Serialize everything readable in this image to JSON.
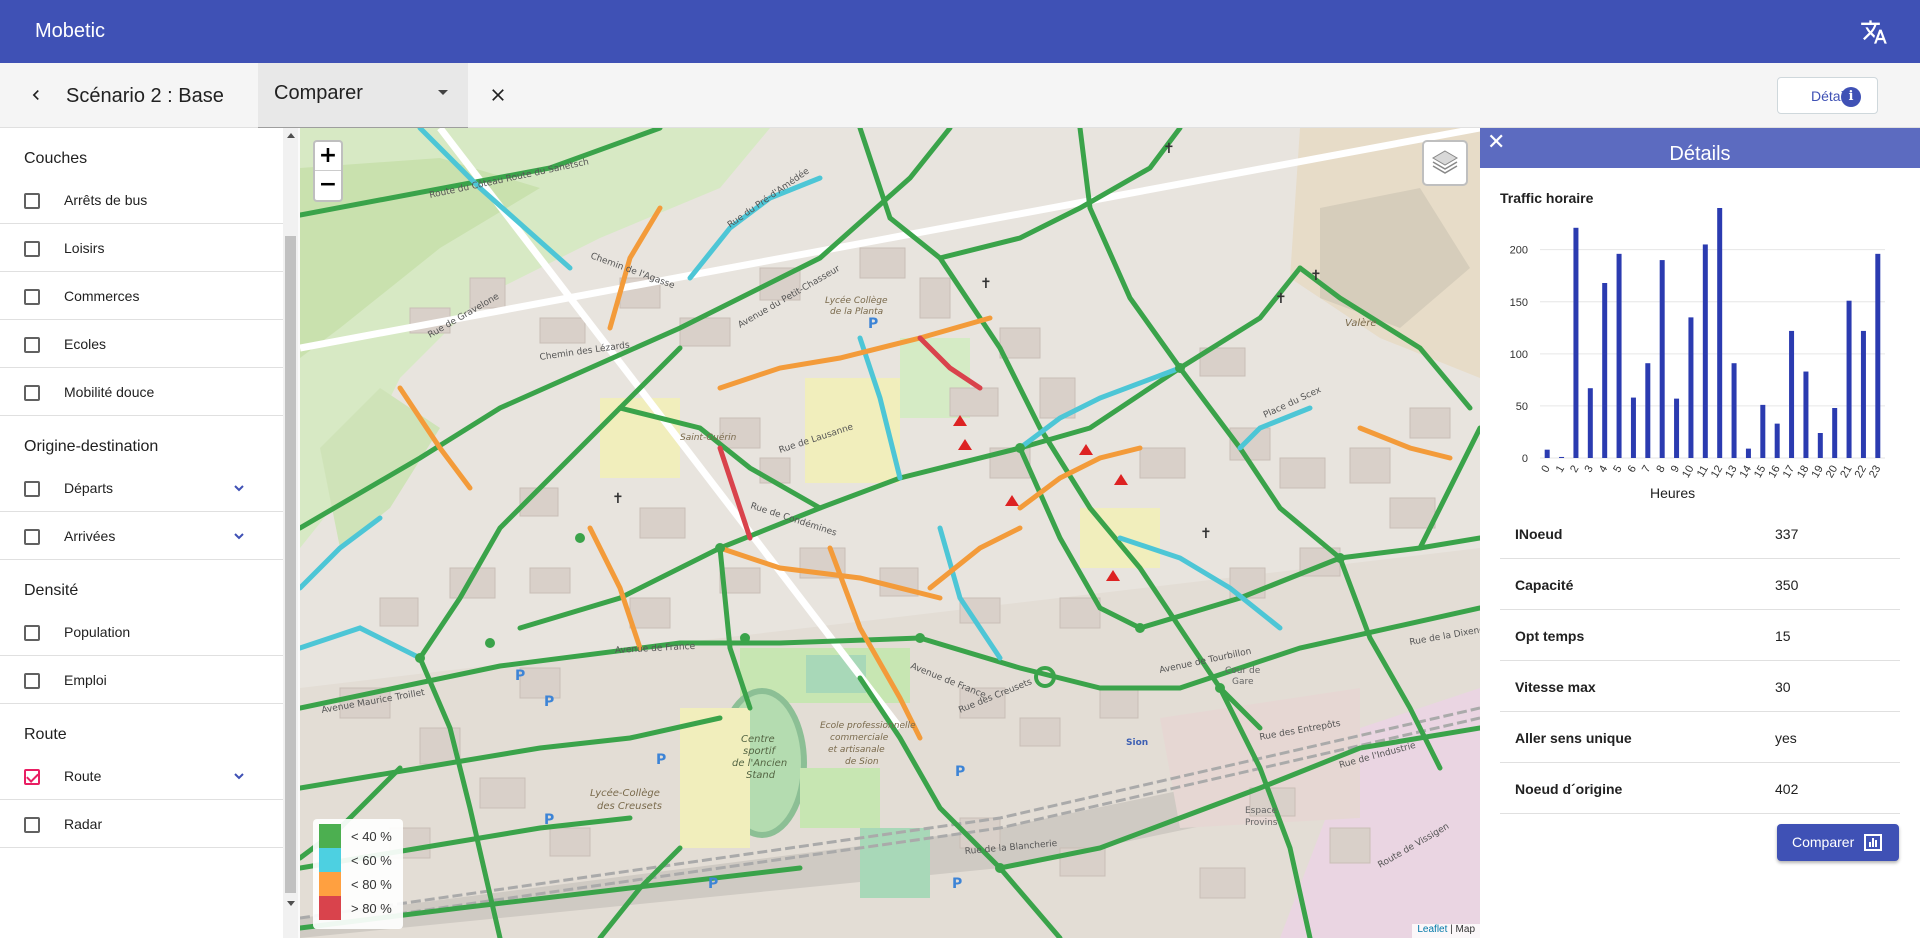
{
  "app": {
    "title": "Mobetic",
    "translate_icon": "translate-icon"
  },
  "toolbar": {
    "scenario": "Scénario 2 : Base",
    "compare_select": "Comparer",
    "detail_button": "Détail"
  },
  "sidebar": {
    "sections": [
      {
        "title": "Couches",
        "items": [
          {
            "label": "Arrêts de bus",
            "checked": false
          },
          {
            "label": "Loisirs",
            "checked": false
          },
          {
            "label": "Commerces",
            "checked": false
          },
          {
            "label": "Ecoles",
            "checked": false
          },
          {
            "label": "Mobilité douce",
            "checked": false
          }
        ]
      },
      {
        "title": "Origine-destination",
        "items": [
          {
            "label": "Départs",
            "checked": false,
            "expandable": true
          },
          {
            "label": "Arrivées",
            "checked": false,
            "expandable": true
          }
        ]
      },
      {
        "title": "Densité",
        "items": [
          {
            "label": "Population",
            "checked": false
          },
          {
            "label": "Emploi",
            "checked": false
          }
        ]
      },
      {
        "title": "Route",
        "items": [
          {
            "label": "Route",
            "checked": true,
            "expandable": true
          },
          {
            "label": "Radar",
            "checked": false
          }
        ]
      }
    ]
  },
  "map": {
    "zoom_in": "+",
    "zoom_out": "−",
    "labels": [
      "Route du Côteau",
      "Route du Sanetsch",
      "Rue de Gravelone",
      "Chemin de l'Agasse",
      "Rue du Pré-d'Amédée",
      "Avenue du Petit-Chasseur",
      "Chemin des Lézards",
      "Lycée-Collège de la Planta",
      "Saint-Guérin",
      "Rue de Lausanne",
      "Avenue de France",
      "Centre sportif de l'Ancien Stand",
      "Ecole professionnelle commerciale et artisanale de Sion",
      "Lycée-Collège des Creusets",
      "Rue de Condémines",
      "Valère",
      "Place du Scex",
      "Espace Provins",
      "Rue des Creusets",
      "Avenue de Tourbillon",
      "Cour de Gare",
      "Rue de l'Industrie",
      "Rue des Entrepôts",
      "Rue de la Blancherie",
      "Sion",
      "Rue de la Dixence",
      "Route de Vissigen"
    ],
    "legend": [
      {
        "label": "< 40 %",
        "color": "#4caf50"
      },
      {
        "label": "< 60 %",
        "color": "#4dd0e1"
      },
      {
        "label": "< 80 %",
        "color": "#ffa040"
      },
      {
        "label": "> 80 %",
        "color": "#d9434c"
      }
    ],
    "attribution_leaflet": "Leaflet",
    "attribution_sep": " | ",
    "attribution_map": "Map"
  },
  "panel": {
    "title": "Détails",
    "chart_title": "Traffic horaire",
    "xlabel": "Heures",
    "rows": [
      {
        "key": "INoeud",
        "value": "337"
      },
      {
        "key": "Capacité",
        "value": "350"
      },
      {
        "key": "Opt temps",
        "value": "15"
      },
      {
        "key": "Vitesse max",
        "value": "30"
      },
      {
        "key": "Aller sens unique",
        "value": "yes"
      },
      {
        "key": "Noeud d´origine",
        "value": "402"
      }
    ],
    "compare_button": "Comparer"
  },
  "chart_data": {
    "type": "bar",
    "title": "Traffic horaire",
    "xlabel": "Heures",
    "ylabel": "",
    "categories": [
      "0",
      "1",
      "2",
      "3",
      "4",
      "5",
      "6",
      "7",
      "8",
      "9",
      "10",
      "11",
      "12",
      "13",
      "14",
      "15",
      "16",
      "17",
      "18",
      "19",
      "20",
      "21",
      "22",
      "23"
    ],
    "values": [
      8,
      1,
      221,
      67,
      168,
      196,
      58,
      91,
      190,
      57,
      135,
      205,
      240,
      91,
      9,
      51,
      33,
      122,
      83,
      24,
      48,
      151,
      122,
      196
    ],
    "ylim": [
      0,
      240
    ],
    "yticks": [
      0,
      50,
      100,
      150,
      200
    ],
    "grid": true,
    "color": "#2b3bb0"
  }
}
